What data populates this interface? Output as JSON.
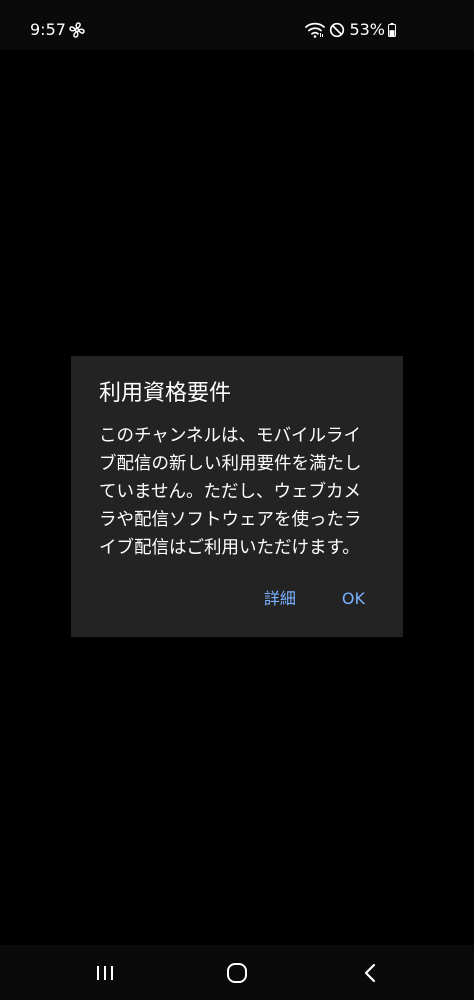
{
  "status_bar": {
    "time": "9:57",
    "battery_percent": "53%",
    "icons": [
      "fan-icon",
      "wifi-icon",
      "do-not-disturb-icon",
      "battery-icon"
    ],
    "battery_level": 0.53
  },
  "dialog": {
    "title": "利用資格要件",
    "message": "このチャンネルは、モバイルライブ配信の新しい利用要件を満たしていません。ただし、ウェブカメラや配信ソフトウェアを使ったライブ配信はご利用いただけます。",
    "details_label": "詳細",
    "ok_label": "OK"
  },
  "navigation_bar": {
    "icons": [
      "recents-icon",
      "home-icon",
      "back-icon"
    ]
  },
  "colors": {
    "background": "#000000",
    "dialog_background": "#232323",
    "accent": "#7ab2ff",
    "text": "#ffffff"
  }
}
